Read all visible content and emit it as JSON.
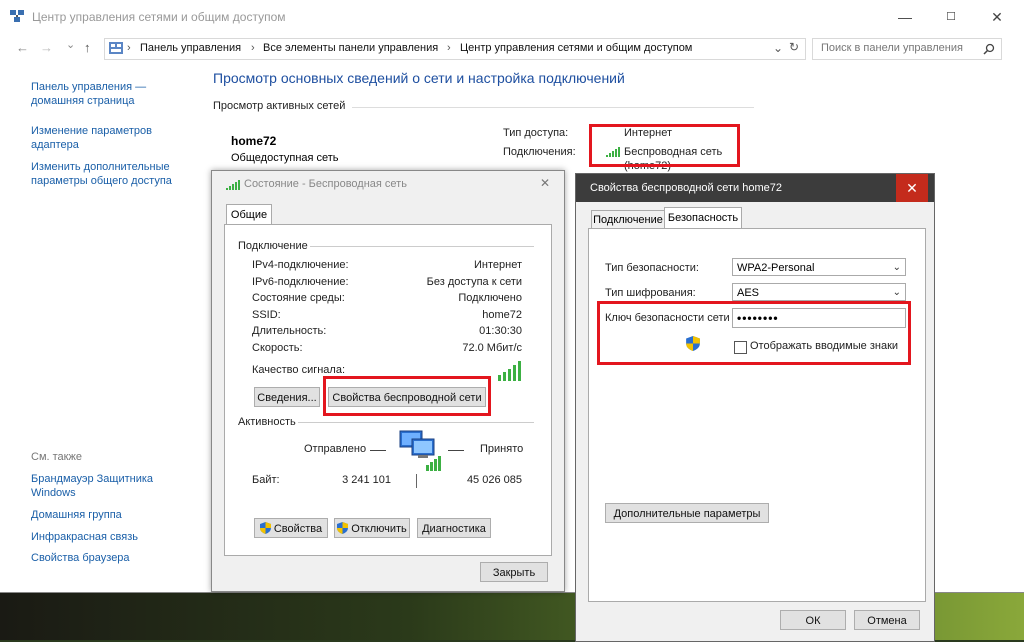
{
  "window": {
    "title": "Центр управления сетями и общим доступом",
    "min": "—",
    "max": "☐",
    "close": "✕"
  },
  "nav": {
    "back": "←",
    "forward": "→",
    "dropdown": "⌄",
    "up": "↑"
  },
  "breadcrumb": [
    "Панель управления",
    "Все элементы панели управления",
    "Центр управления сетями и общим доступом"
  ],
  "breadcrumb_sep": "›",
  "search": {
    "placeholder": "Поиск в панели управления"
  },
  "sidebar": {
    "home": [
      "Панель управления —",
      "домашняя страница"
    ],
    "adapter": [
      "Изменение параметров",
      "адаптера"
    ],
    "sharing": [
      "Изменить дополнительные",
      "параметры общего доступа"
    ],
    "see_also": "См. также",
    "firewall": [
      "Брандмауэр Защитника",
      "Windows"
    ],
    "homegroup": "Домашняя группа",
    "infrared": "Инфракрасная связь",
    "browser": "Свойства браузера"
  },
  "main": {
    "header": "Просмотр основных сведений о сети и настройка подключений",
    "active_networks": "Просмотр активных сетей",
    "network_name": "home72",
    "network_type": "Общедоступная сеть",
    "access_type_label": "Тип доступа:",
    "access_type_value": "Интернет",
    "connections_label": "Подключения:",
    "connection_value": "Беспроводная сеть",
    "connection_sub": "(home72)"
  },
  "status_dialog": {
    "title": "Состояние - Беспроводная сеть",
    "tab": "Общие",
    "connection_group": "Подключение",
    "rows": [
      {
        "label": "IPv4-подключение:",
        "value": "Интернет"
      },
      {
        "label": "IPv6-подключение:",
        "value": "Без доступа к сети"
      },
      {
        "label": "Состояние среды:",
        "value": "Подключено"
      },
      {
        "label": "SSID:",
        "value": "home72"
      },
      {
        "label": "Длительность:",
        "value": "01:30:30"
      },
      {
        "label": "Скорость:",
        "value": "72.0 Мбит/с"
      }
    ],
    "signal_label": "Качество сигнала:",
    "details_button": "Сведения...",
    "wireless_props_button": "Свойства беспроводной сети",
    "activity_group": "Активность",
    "sent_label": "Отправлено",
    "received_label": "Принято",
    "bytes_label": "Байт:",
    "bytes_sent": "3 241 101",
    "bytes_received": "45 026 085",
    "properties_button": "Свойства",
    "disable_button": "Отключить",
    "diagnose_button": "Диагностика",
    "close_button": "Закрыть"
  },
  "wireless_dialog": {
    "title": "Свойства беспроводной сети home72",
    "tab_connection": "Подключение",
    "tab_security": "Безопасность",
    "security_type_label": "Тип безопасности:",
    "security_type_value": "WPA2-Personal",
    "encryption_label": "Тип шифрования:",
    "encryption_value": "AES",
    "key_label": "Ключ безопасности сети",
    "key_value": "••••••••",
    "show_chars_label": "Отображать вводимые знаки",
    "advanced_button": "Дополнительные параметры",
    "ok_button": "ОК",
    "cancel_button": "Отмена"
  },
  "colors": {
    "highlight": "#e3161e",
    "link": "#1a5fa8",
    "header": "#1e4fa0",
    "signal": "#3cb043"
  }
}
